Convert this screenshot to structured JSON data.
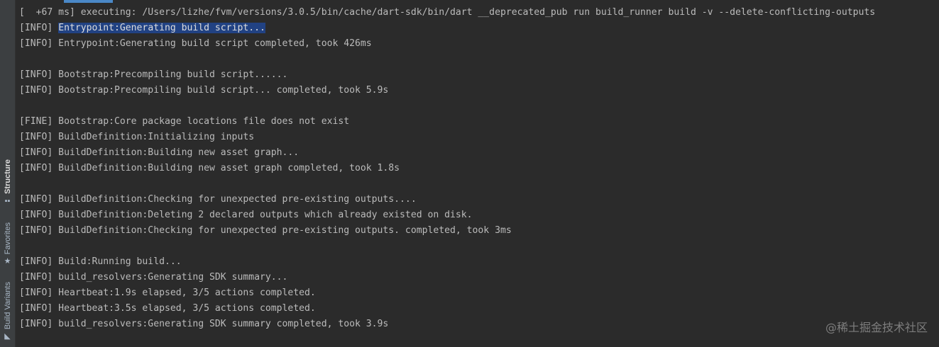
{
  "sidebar": {
    "tabs": [
      {
        "label": "Structure",
        "icon": "structure-icon"
      },
      {
        "label": "Favorites",
        "icon": "star-icon"
      },
      {
        "label": "Build Variants",
        "icon": "build-variants-icon"
      }
    ]
  },
  "console": {
    "command_line": "[  +67 ms] executing: /Users/lizhe/fvm/versions/3.0.5/bin/cache/dart-sdk/bin/dart __deprecated_pub run build_runner build -v --delete-conflicting-outputs",
    "highlight_prefix": "[INFO] ",
    "highlight_text": "Entrypoint:Generating build script...",
    "lines": [
      "[INFO] Entrypoint:Generating build script completed, took 426ms",
      "",
      "[INFO] Bootstrap:Precompiling build script......",
      "[INFO] Bootstrap:Precompiling build script... completed, took 5.9s",
      "",
      "[FINE] Bootstrap:Core package locations file does not exist",
      "[INFO] BuildDefinition:Initializing inputs",
      "[INFO] BuildDefinition:Building new asset graph...",
      "[INFO] BuildDefinition:Building new asset graph completed, took 1.8s",
      "",
      "[INFO] BuildDefinition:Checking for unexpected pre-existing outputs....",
      "[INFO] BuildDefinition:Deleting 2 declared outputs which already existed on disk.",
      "[INFO] BuildDefinition:Checking for unexpected pre-existing outputs. completed, took 3ms",
      "",
      "[INFO] Build:Running build...",
      "[INFO] build_resolvers:Generating SDK summary...",
      "[INFO] Heartbeat:1.9s elapsed, 3/5 actions completed.",
      "[INFO] Heartbeat:3.5s elapsed, 3/5 actions completed.",
      "[INFO] build_resolvers:Generating SDK summary completed, took 3.9s"
    ]
  },
  "watermark": "@稀土掘金技术社区"
}
